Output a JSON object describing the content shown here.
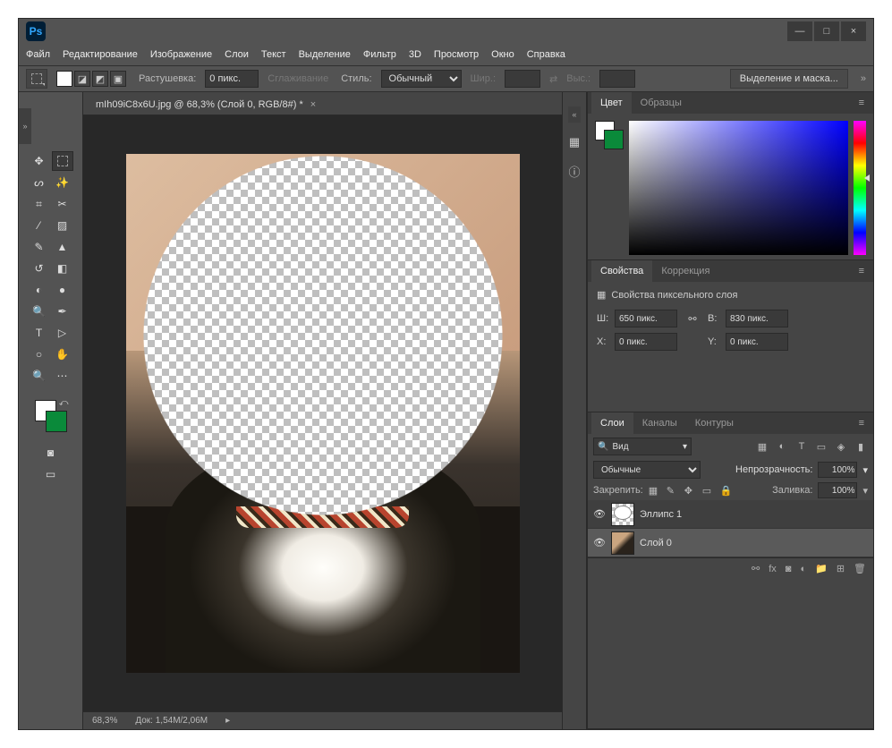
{
  "app_icon": "Ps",
  "menus": [
    "Файл",
    "Редактирование",
    "Изображение",
    "Слои",
    "Текст",
    "Выделение",
    "Фильтр",
    "3D",
    "Просмотр",
    "Окно",
    "Справка"
  ],
  "options_bar": {
    "feather_label": "Растушевка:",
    "feather_value": "0 пикс.",
    "antialias": "Сглаживание",
    "style_label": "Стиль:",
    "style_value": "Обычный",
    "width_label": "Шир.:",
    "height_label": "Выс.:",
    "mask_button": "Выделение и маска..."
  },
  "doc_tab": {
    "title": "mIh09iC8x6U.jpg @ 68,3% (Слой 0, RGB/8#) *",
    "close": "×"
  },
  "status": {
    "zoom": "68,3%",
    "doc_size": "Док: 1,54M/2,06M"
  },
  "panels": {
    "color": {
      "tab1": "Цвет",
      "tab2": "Образцы"
    },
    "properties": {
      "tab1": "Свойства",
      "tab2": "Коррекция",
      "title": "Свойства пиксельного слоя",
      "w_label": "Ш:",
      "w_value": "650 пикс.",
      "h_label": "В:",
      "h_value": "830 пикс.",
      "x_label": "X:",
      "x_value": "0 пикс.",
      "y_label": "Y:",
      "y_value": "0 пикс."
    },
    "layers": {
      "tab1": "Слои",
      "tab2": "Каналы",
      "tab3": "Контуры",
      "filter_label": "Вид",
      "blend_mode": "Обычные",
      "opacity_label": "Непрозрачность:",
      "opacity_value": "100%",
      "lock_label": "Закрепить:",
      "fill_label": "Заливка:",
      "fill_value": "100%",
      "layer1": "Эллипс 1",
      "layer2": "Слой 0"
    }
  },
  "colors": {
    "fg": "#ffffff",
    "bg": "#0a8a3a"
  }
}
